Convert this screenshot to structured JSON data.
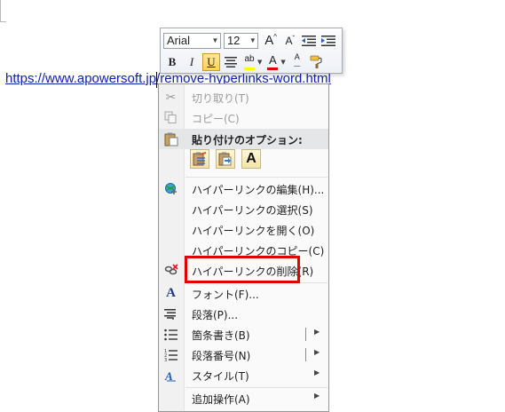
{
  "document": {
    "link_text": "https://www.apowersoft.jp/remove-hyperlinks-word.html"
  },
  "mini_toolbar": {
    "font_name": "Arial",
    "font_size": "12",
    "bold": "B",
    "italic": "I",
    "underline": "U",
    "highlight_glyph": "ab",
    "font_color_glyph": "A",
    "grow_font": "A",
    "shrink_font": "A",
    "clear_format_glyph": "A",
    "highlight_color": "#ffff00",
    "font_color": "#e00000"
  },
  "context_menu": {
    "items": [
      {
        "label": "切り取り(T)",
        "icon": "scissors-icon",
        "enabled": false
      },
      {
        "label": "コピー(C)",
        "icon": "copy-icon",
        "enabled": false
      },
      {
        "label": "貼り付けのオプション:",
        "icon": "paste-icon",
        "header": true
      },
      {
        "label": "ハイパーリンクの編集(H)...",
        "icon": "globe-link-icon"
      },
      {
        "label": "ハイパーリンクの選択(S)"
      },
      {
        "label": "ハイパーリンクを開く(O)"
      },
      {
        "label": "ハイパーリンクのコピー(C)"
      },
      {
        "label": "ハイパーリンクの削除(R)",
        "icon": "remove-link-icon",
        "highlighted": true
      },
      {
        "label": "フォント(F)...",
        "icon": "font-icon"
      },
      {
        "label": "段落(P)...",
        "icon": "paragraph-icon"
      },
      {
        "label": "箇条書き(B)",
        "icon": "bullets-icon",
        "submenu": true
      },
      {
        "label": "段落番号(N)",
        "icon": "numbering-icon",
        "submenu": true
      },
      {
        "label": "スタイル(T)",
        "icon": "styles-icon",
        "submenu": true
      },
      {
        "label": "追加操作(A)",
        "submenu": true
      }
    ],
    "paste_option_icons": [
      "paste-keep-format-icon",
      "paste-merge-format-icon",
      "paste-text-only-icon"
    ],
    "paste_text_only_glyph": "A",
    "highlight_color": "#e00000"
  }
}
